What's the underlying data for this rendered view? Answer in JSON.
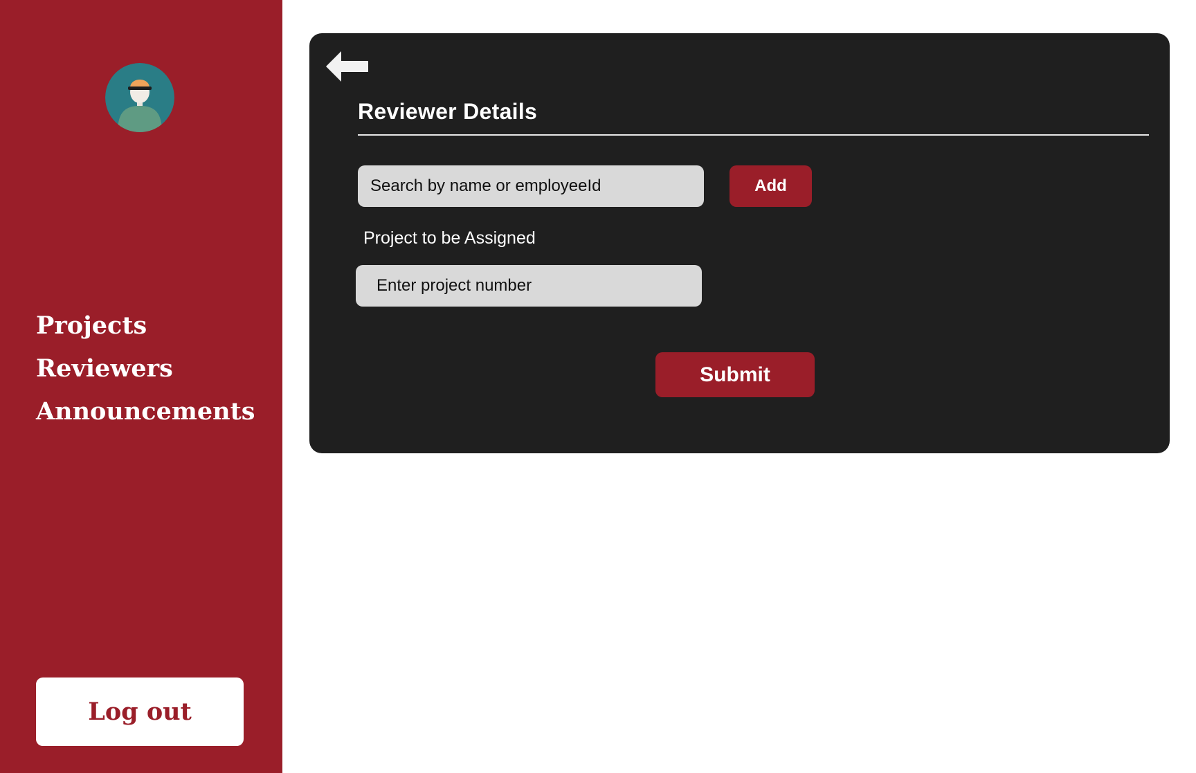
{
  "sidebar": {
    "avatar_icon": "user-avatar-icon",
    "nav": [
      {
        "label": "Projects"
      },
      {
        "label": "Reviewers"
      },
      {
        "label": "Announcements"
      }
    ],
    "logout_label": "Log out"
  },
  "card": {
    "back_icon": "arrow-left-icon",
    "title": "Reviewer Details",
    "search": {
      "placeholder": "Search by name or employeeId",
      "value": ""
    },
    "add_label": "Add",
    "project_label": "Project to be Assigned",
    "project_input": {
      "placeholder": "Enter project number",
      "value": ""
    },
    "submit_label": "Submit"
  },
  "colors": {
    "sidebar_bg": "#9a1e29",
    "accent": "#9a1e29",
    "card_bg": "#1f1f1f",
    "input_bg": "#d9d9d9",
    "text_light": "#ffffff"
  }
}
